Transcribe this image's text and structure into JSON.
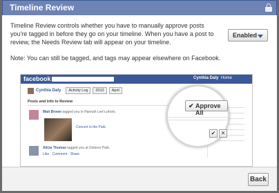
{
  "dialog": {
    "title": "Timeline Review",
    "description": "Timeline Review controls whether you have to manually approve posts you're tagged in before they go on your timeline. When you have a post to review, the Needs Review tab will appear on your timeline.",
    "note": "Note: You can still be tagged, and tags may appear elsewhere on Facebook.",
    "setting_label": "Enabled",
    "back_label": "Back"
  },
  "preview": {
    "logo": "facebook",
    "top_user": "Cynthia Daly",
    "home_label": "Home",
    "profile_name": "Cynthia Daly",
    "filters": [
      "Activity Log",
      "2012",
      "April"
    ],
    "section_heading": "Posts and Info to Review",
    "post1": {
      "author": "Matt Brown",
      "text": "tagged you in Hannah Lee's photo.",
      "photo_caption": "Concert in the Park."
    },
    "post2": {
      "author": "Alicia Thomas",
      "text": "tagged you at Dolores Park.",
      "meta": "Like · Comment · Share"
    },
    "approve_all_label": "Approve All",
    "approve_icon": "✔",
    "reject_icon": "✕"
  },
  "colors": {
    "facebook_blue": "#3b5998",
    "title_bar": "#6d84b4"
  }
}
